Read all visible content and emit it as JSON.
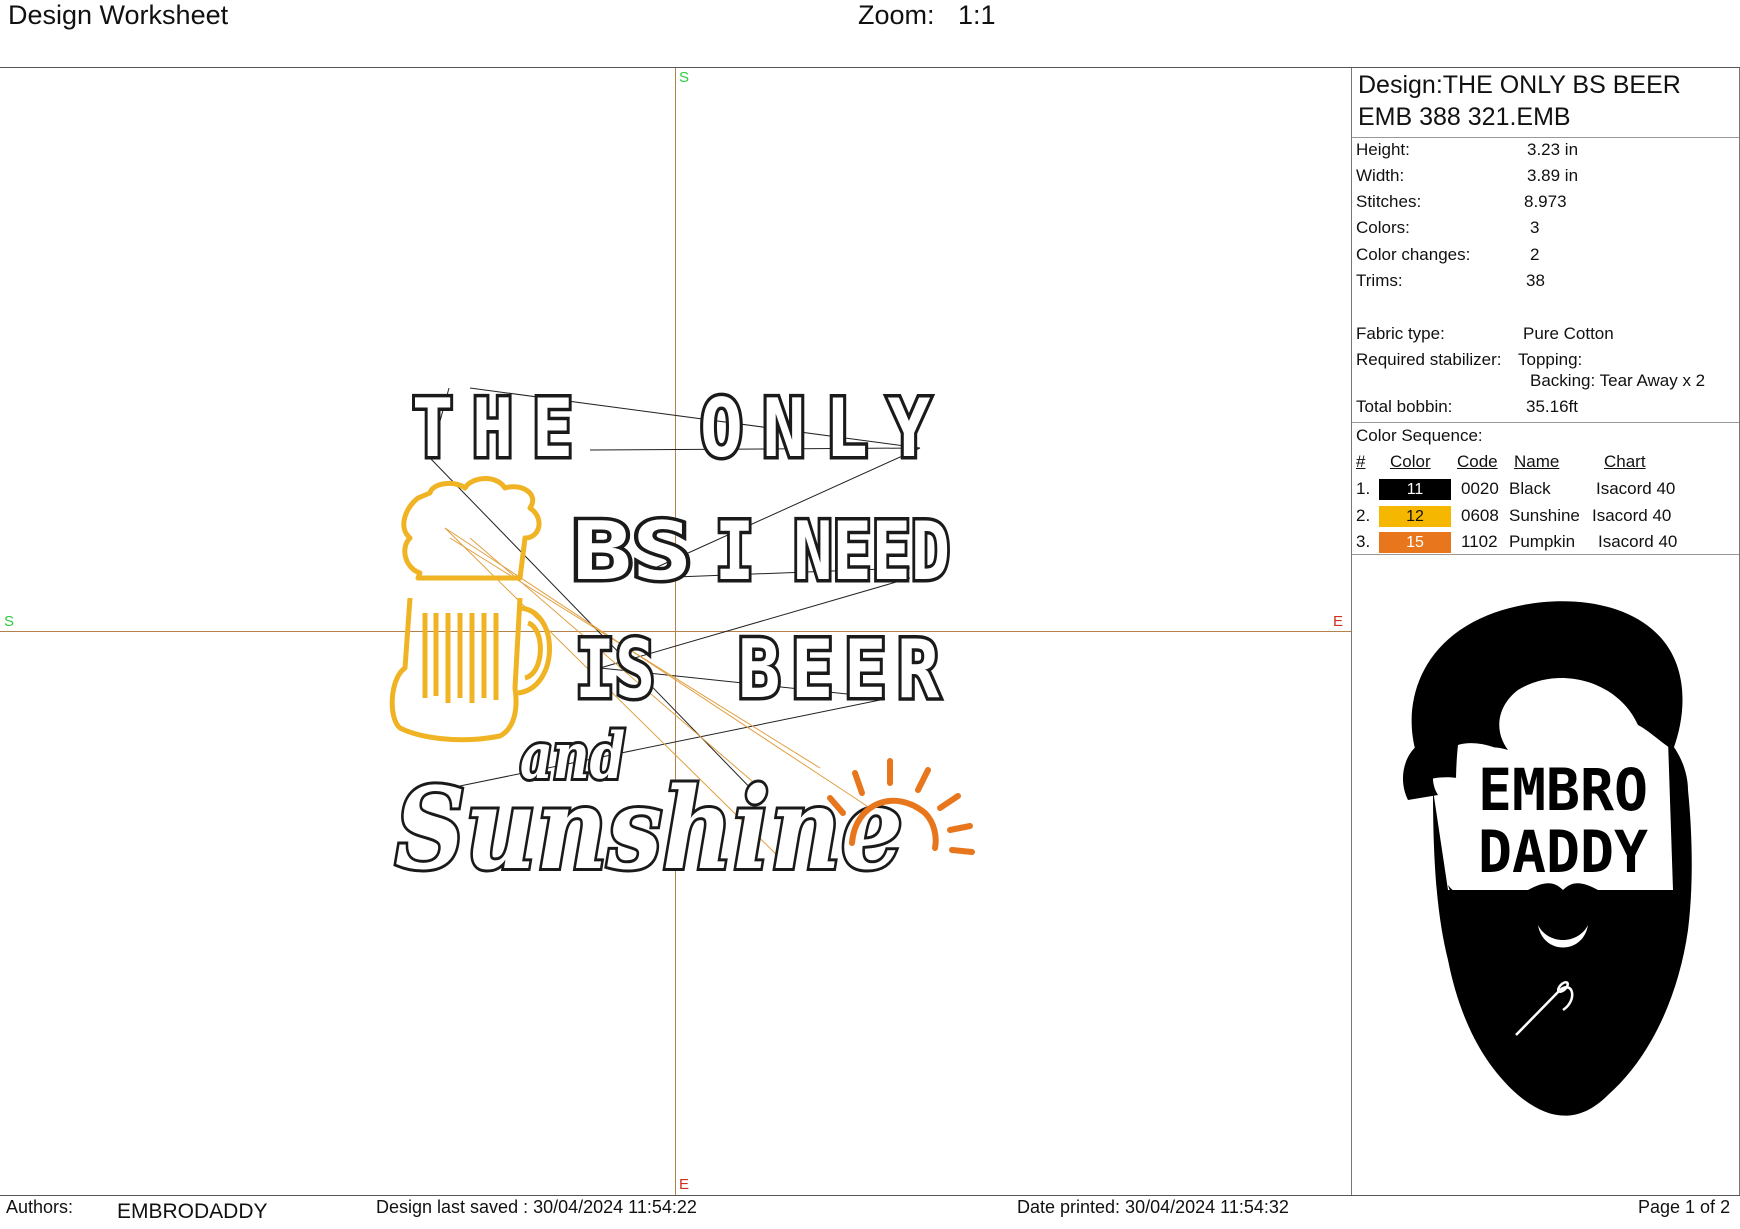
{
  "header": {
    "title": "Design Worksheet",
    "zoom_label": "Zoom:",
    "zoom_value": "1:1"
  },
  "canvas": {
    "axis_marks": {
      "top": "S",
      "left": "S",
      "right": "E",
      "bottom": "E"
    },
    "design_text": {
      "line1_left": "THE",
      "line1_right": "ONLY",
      "line2_left": "BS",
      "line2_right": "I NEED",
      "line3_left": "IS",
      "line3_right": "BEER",
      "script_small": "and",
      "script_large": "Sunshine"
    },
    "colors": {
      "black": "#111111",
      "sunshine": "#f0b323",
      "pumpkin": "#e8761c",
      "axis": "#b4824a"
    }
  },
  "info_panel": {
    "design_title": "Design:THE ONLY BS BEER",
    "design_file": "EMB 388 321.EMB",
    "stats": [
      {
        "label": "Height:",
        "value": "3.23 in"
      },
      {
        "label": "Width:",
        "value": "3.89 in"
      },
      {
        "label": "Stitches:",
        "value": "8.973"
      },
      {
        "label": "Colors:",
        "value": "3"
      },
      {
        "label": "Color changes:",
        "value": "2"
      },
      {
        "label": "Trims:",
        "value": "38"
      }
    ],
    "fabric_label": "Fabric type:",
    "fabric_value": "Pure Cotton",
    "stabilizer_label": "Required stabilizer:",
    "stabilizer_topping": "Topping:",
    "stabilizer_backing": "Backing: Tear Away x 2",
    "bobbin_label": "Total bobbin:",
    "bobbin_value": "35.16ft",
    "sequence_title": "Color Sequence:",
    "sequence_headers": {
      "num": "#",
      "color": "Color",
      "code": "Code",
      "name": "Name",
      "chart": "Chart"
    },
    "sequence": [
      {
        "num": "1.",
        "swatch": "11",
        "hex": "#000000",
        "text_color": "#ffffff",
        "code": "0020",
        "name": "Black",
        "chart": "Isacord 40"
      },
      {
        "num": "2.",
        "swatch": "12",
        "hex": "#f5b700",
        "text_color": "#111111",
        "code": "0608",
        "name": "Sunshine",
        "chart": "Isacord 40"
      },
      {
        "num": "3.",
        "swatch": "15",
        "hex": "#e8761c",
        "text_color": "#ffffff",
        "code": "1102",
        "name": "Pumpkin",
        "chart": "Isacord 40"
      }
    ],
    "logo": {
      "line1": "EMBRO",
      "line2": "DADDY"
    }
  },
  "footer": {
    "authors_label": "Authors:",
    "authors_value": "EMBRODADDY",
    "saved": "Design last saved : 30/04/2024 11:54:22",
    "printed": "Date printed: 30/04/2024 11:54:32",
    "page": "Page 1 of 2"
  }
}
